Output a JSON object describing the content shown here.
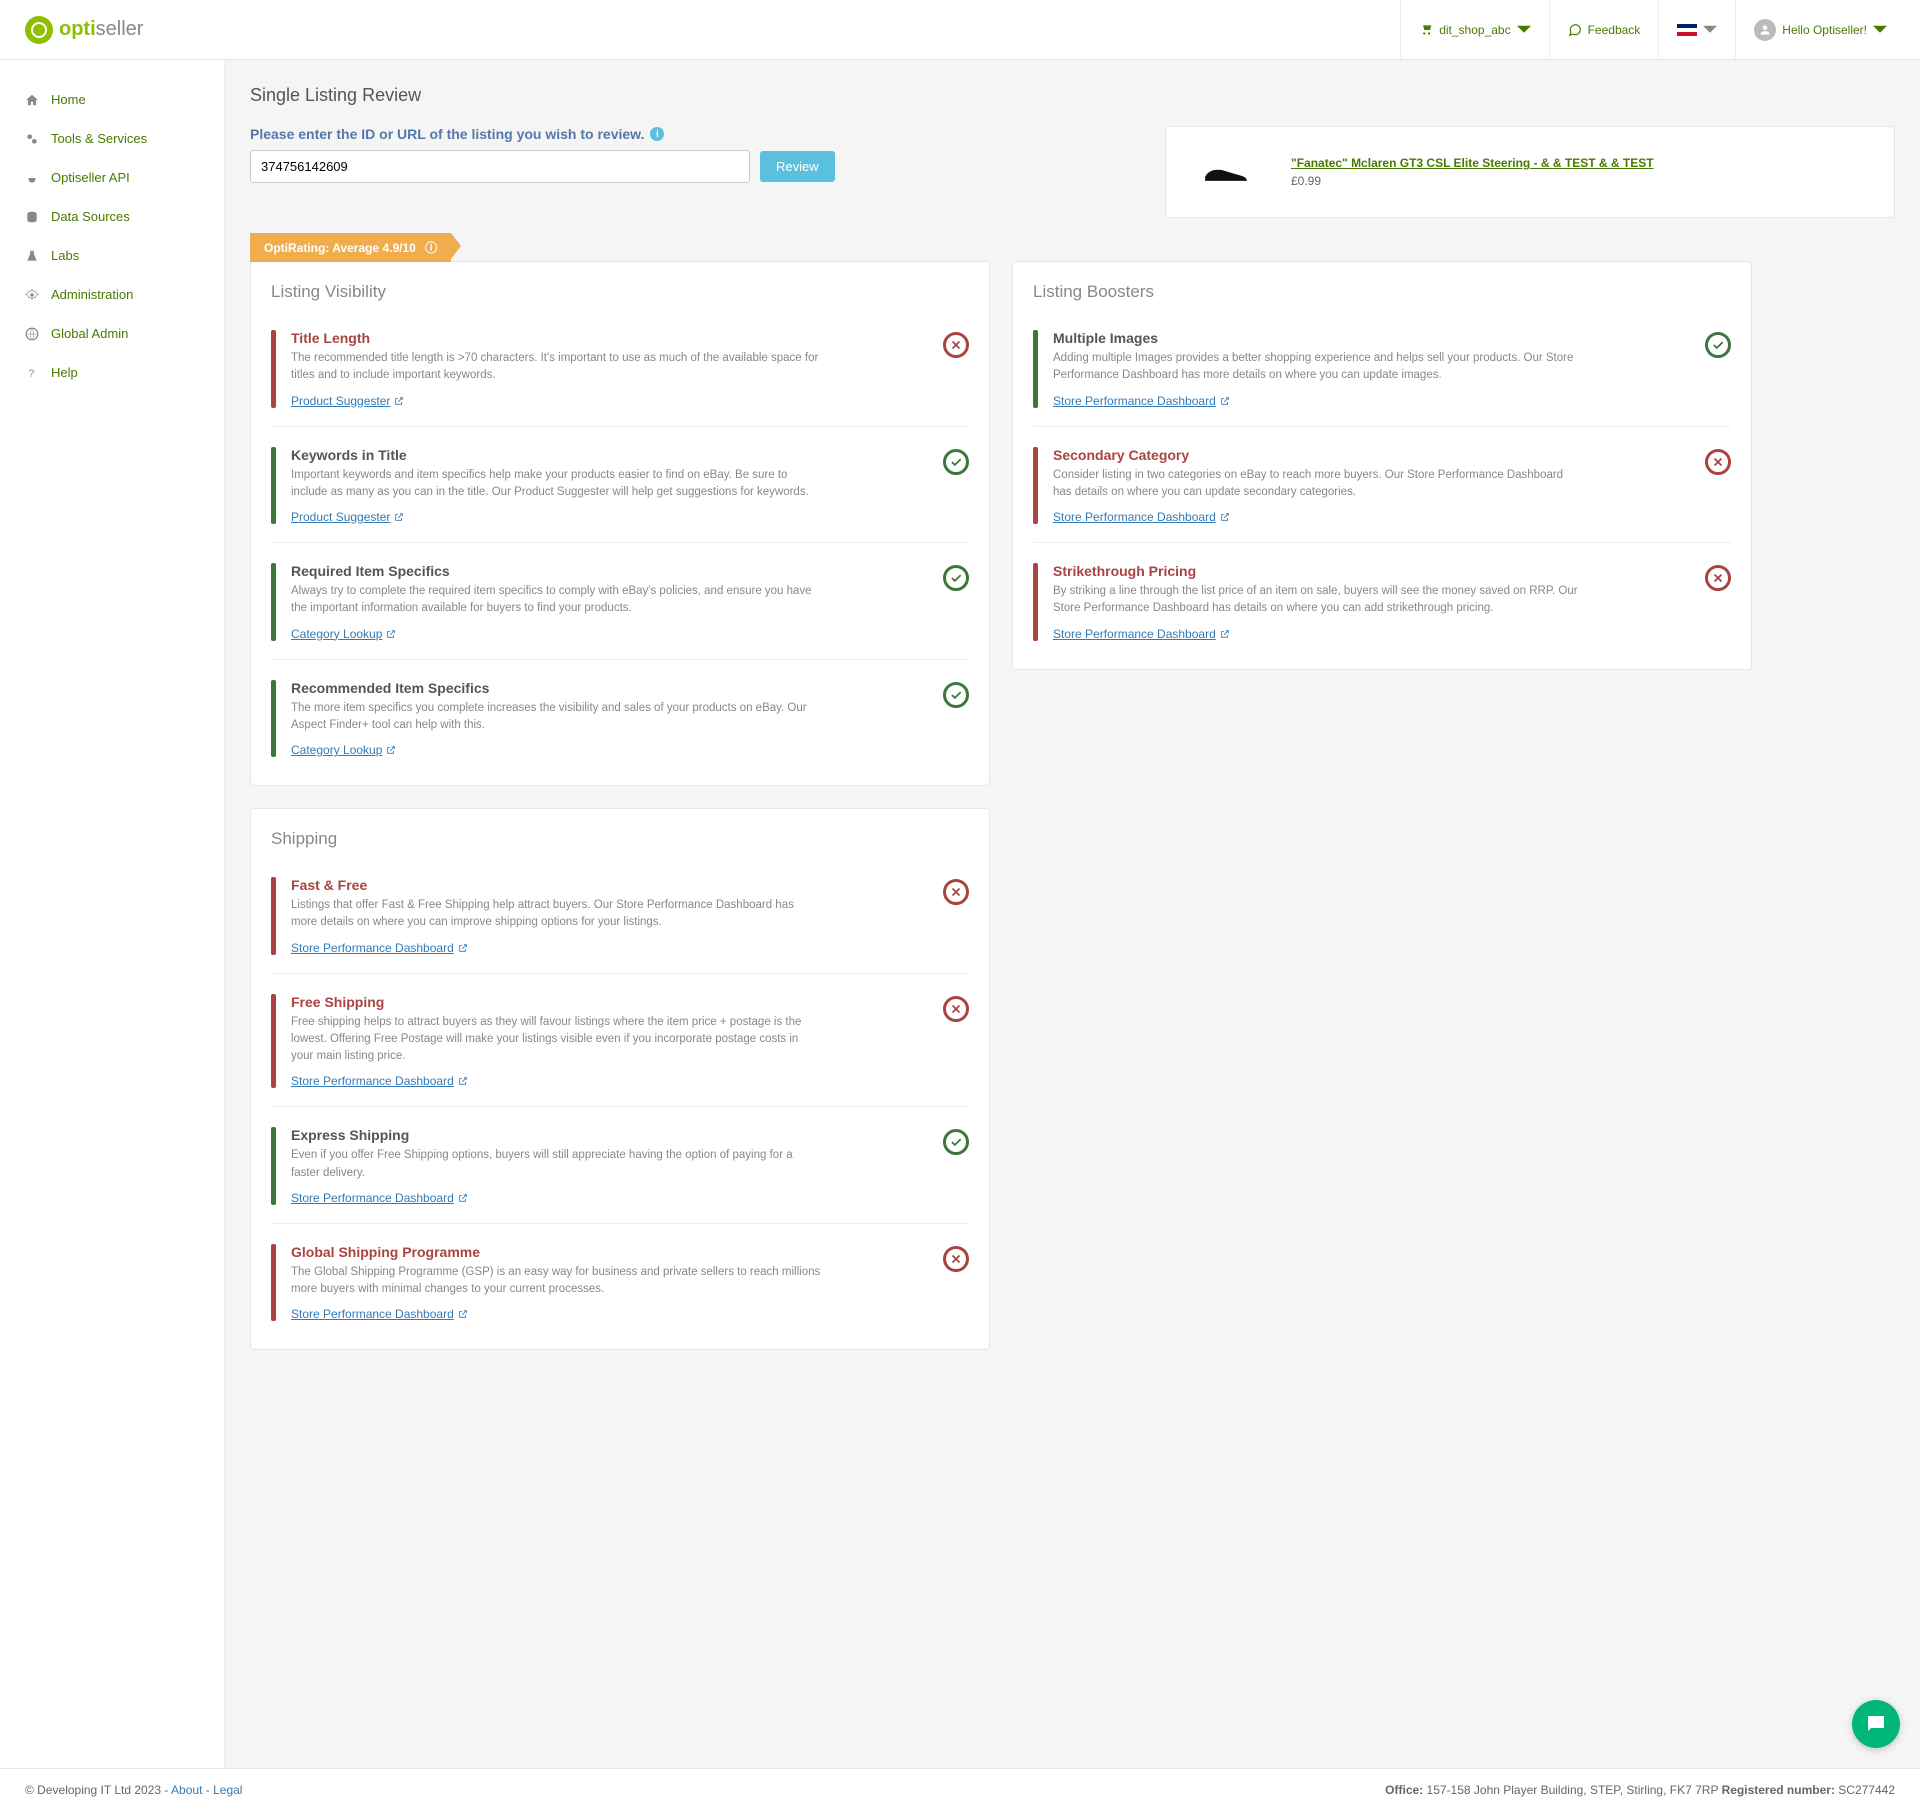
{
  "brand": {
    "part1": "opti",
    "part2": "seller"
  },
  "topbar": {
    "shop": "dit_shop_abc",
    "feedback": "Feedback",
    "greeting": "Hello Optiseller!"
  },
  "sidebar": {
    "items": [
      {
        "label": "Home"
      },
      {
        "label": "Tools & Services"
      },
      {
        "label": "Optiseller API"
      },
      {
        "label": "Data Sources"
      },
      {
        "label": "Labs"
      },
      {
        "label": "Administration"
      },
      {
        "label": "Global Admin"
      },
      {
        "label": "Help"
      }
    ]
  },
  "page": {
    "title": "Single Listing Review",
    "search_label": "Please enter the ID or URL of the listing you wish to review.",
    "input_value": "374756142609",
    "review_btn": "Review",
    "optirating": "OptiRating: Average 4.9/10"
  },
  "product": {
    "title": "\"Fanatec\" Mclaren GT3 CSL Elite Steering - & & TEST & & TEST",
    "price": "£0.99"
  },
  "panels": {
    "visibility": {
      "title": "Listing Visibility",
      "items": [
        {
          "status": "fail",
          "title": "Title Length",
          "desc": "The recommended title length is >70 characters. It's important to use as much of the available space for titles and to include important keywords.",
          "link": "Product Suggester"
        },
        {
          "status": "pass",
          "title": "Keywords in Title",
          "desc": "Important keywords and item specifics help make your products easier to find on eBay. Be sure to include as many as you can in the title. Our Product Suggester will help get suggestions for keywords.",
          "link": "Product Suggester"
        },
        {
          "status": "pass",
          "title": "Required Item Specifics",
          "desc": "Always try to complete the required item specifics to comply with eBay's policies, and ensure you have the important information available for buyers to find your products.",
          "link": "Category Lookup"
        },
        {
          "status": "pass",
          "title": "Recommended Item Specifics",
          "desc": "The more item specifics you complete increases the visibility and sales of your products on eBay. Our Aspect Finder+ tool can help with this.",
          "link": "Category Lookup"
        }
      ]
    },
    "boosters": {
      "title": "Listing Boosters",
      "items": [
        {
          "status": "pass",
          "title": "Multiple Images",
          "desc": "Adding multiple Images provides a better shopping experience and helps sell your products. Our Store Performance Dashboard has more details on where you can update images.",
          "link": "Store Performance Dashboard"
        },
        {
          "status": "fail",
          "title": "Secondary Category",
          "desc": "Consider listing in two categories on eBay to reach more buyers. Our Store Performance Dashboard has details on where you can update secondary categories.",
          "link": "Store Performance Dashboard"
        },
        {
          "status": "fail",
          "title": "Strikethrough Pricing",
          "desc": "By striking a line through the list price of an item on sale, buyers will see the money saved on RRP. Our Store Performance Dashboard has details on where you can add strikethrough pricing.",
          "link": "Store Performance Dashboard"
        }
      ]
    },
    "shipping": {
      "title": "Shipping",
      "items": [
        {
          "status": "fail",
          "title": "Fast & Free",
          "desc": "Listings that offer Fast & Free Shipping help attract buyers. Our Store Performance Dashboard has more details on where you can improve shipping options for your listings.",
          "link": "Store Performance Dashboard"
        },
        {
          "status": "fail",
          "title": "Free Shipping",
          "desc": "Free shipping helps to attract buyers as they will favour listings where the item price + postage is the lowest. Offering Free Postage will make your listings visible even if you incorporate postage costs in your main listing price.",
          "link": "Store Performance Dashboard"
        },
        {
          "status": "pass",
          "title": "Express Shipping",
          "desc": "Even if you offer Free Shipping options, buyers will still appreciate having the option of paying for a faster delivery.",
          "link": "Store Performance Dashboard"
        },
        {
          "status": "fail",
          "title": "Global Shipping Programme",
          "desc": "The Global Shipping Programme (GSP) is an easy way for business and private sellers to reach millions more buyers with minimal changes to your current processes.",
          "link": "Store Performance Dashboard"
        }
      ]
    }
  },
  "footer": {
    "copyright": "© Developing IT Ltd 2023 - ",
    "about": "About",
    "sep": " - ",
    "legal": "Legal",
    "office_label": "Office:",
    "office": " 157-158 John Player Building, STEP, Stirling, FK7 7RP ",
    "reg_label": "Registered number:",
    "reg": " SC277442"
  }
}
